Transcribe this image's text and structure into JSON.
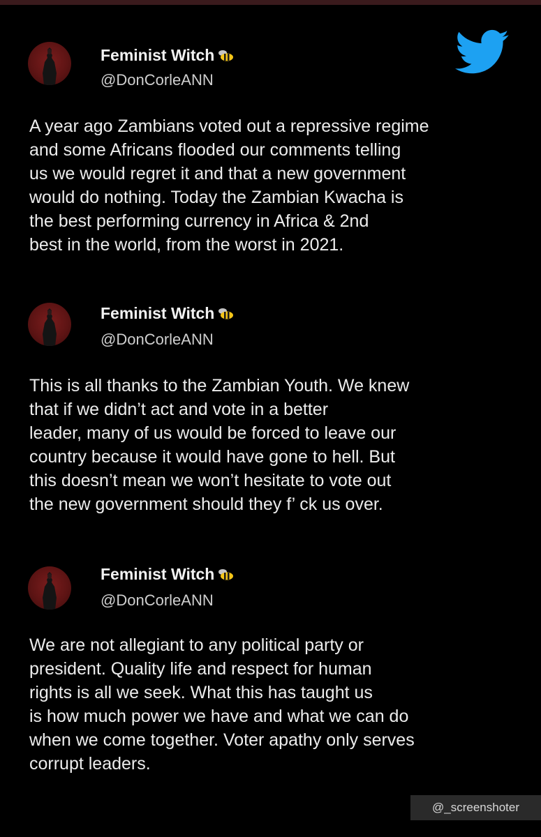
{
  "tweets": [
    {
      "name": "Feminist Witch",
      "handle": "@DonCorleANN",
      "lines": [
        "A year ago Zambians voted out a repressive regime",
        "and some Africans flooded our comments telling",
        "us we would regret it and that a new government",
        "would do nothing. Today the Zambian Kwacha is",
        "the best performing currency in Africa & 2nd",
        "best in the world, from the worst in 2021."
      ]
    },
    {
      "name": "Feminist Witch",
      "handle": "@DonCorleANN",
      "lines": [
        "This is all thanks to the Zambian Youth. We knew",
        "that if we didn’t act and vote in a better",
        "leader, many of us would be forced to leave our",
        "country because it would have gone to hell. But",
        "this doesn’t mean we won’t hesitate to vote out",
        "the new government should they f’ ck us over."
      ]
    },
    {
      "name": "Feminist Witch",
      "handle": "@DonCorleANN",
      "lines": [
        "We are not allegiant to any political party or",
        "president. Quality life and respect for human",
        "rights is all we seek. What this has taught us",
        "is how much power we have and what we can do",
        "when we come together. Voter apathy only serves",
        "corrupt leaders."
      ]
    }
  ],
  "watermark": "@_screenshoter",
  "icons": {
    "logo": "twitter-bird-icon",
    "emoji": "bee-icon"
  },
  "colors": {
    "background": "#000000",
    "twitter_blue": "#1da1f2",
    "top_rule": "#3a1a1c"
  }
}
